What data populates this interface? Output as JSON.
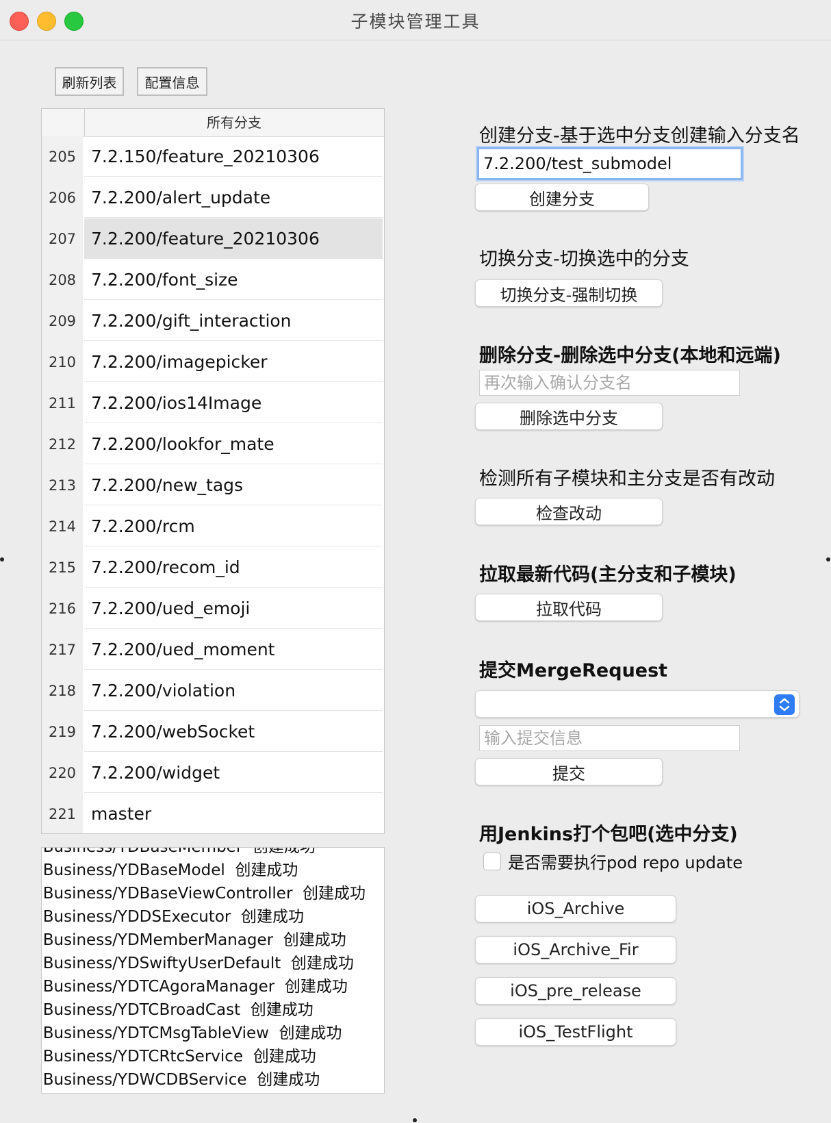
{
  "window": {
    "title": "子模块管理工具"
  },
  "toolbar": {
    "refresh_label": "刷新列表",
    "config_label": "配置信息"
  },
  "branches": {
    "header": "所有分支",
    "rows": [
      {
        "index": "205",
        "name": "7.2.150/feature_20210306"
      },
      {
        "index": "206",
        "name": "7.2.200/alert_update"
      },
      {
        "index": "207",
        "name": "7.2.200/feature_20210306"
      },
      {
        "index": "208",
        "name": "7.2.200/font_size"
      },
      {
        "index": "209",
        "name": "7.2.200/gift_interaction"
      },
      {
        "index": "210",
        "name": "7.2.200/imagepicker"
      },
      {
        "index": "211",
        "name": "7.2.200/ios14Image"
      },
      {
        "index": "212",
        "name": "7.2.200/lookfor_mate"
      },
      {
        "index": "213",
        "name": "7.2.200/new_tags"
      },
      {
        "index": "214",
        "name": "7.2.200/rcm"
      },
      {
        "index": "215",
        "name": "7.2.200/recom_id"
      },
      {
        "index": "216",
        "name": "7.2.200/ued_emoji"
      },
      {
        "index": "217",
        "name": "7.2.200/ued_moment"
      },
      {
        "index": "218",
        "name": "7.2.200/violation"
      },
      {
        "index": "219",
        "name": "7.2.200/webSocket"
      },
      {
        "index": "220",
        "name": "7.2.200/widget"
      },
      {
        "index": "221",
        "name": "master"
      }
    ],
    "selected_index": "207"
  },
  "log": {
    "lines": [
      ":Business/YDBaseMember  创建成功",
      ":Business/YDBaseModel  创建成功",
      ":Business/YDBaseViewController  创建成功",
      ":Business/YDDSExecutor  创建成功",
      ":Business/YDMemberManager  创建成功",
      ":Business/YDSwiftyUserDefault  创建成功",
      ":Business/YDTCAgoraManager  创建成功",
      ":Business/YDTCBroadCast  创建成功",
      ":Business/YDTCMsgTableView  创建成功",
      ":Business/YDTCRtcService  创建成功",
      ":Business/YDWCDBService  创建成功"
    ]
  },
  "create_branch": {
    "title": "创建分支-基于选中分支创建输入分支名",
    "input_value": "7.2.200/test_submodel",
    "button": "创建分支"
  },
  "switch_branch": {
    "title": "切换分支-切换选中的分支",
    "button": "切换分支-强制切换"
  },
  "delete_branch": {
    "title": "删除分支-删除选中分支(本地和远端)",
    "placeholder": "再次输入确认分支名",
    "button": "删除选中分支"
  },
  "check_changes": {
    "title": "检测所有子模块和主分支是否有改动",
    "button": "检查改动"
  },
  "pull_code": {
    "title": "拉取最新代码(主分支和子模块)",
    "button": "拉取代码"
  },
  "merge_request": {
    "title": "提交MergeRequest",
    "select_value": "",
    "placeholder": "输入提交信息",
    "button": "提交"
  },
  "jenkins": {
    "title": "用Jenkins打个包吧(选中分支)",
    "checkbox_label": "是否需要执行pod repo update",
    "checkbox_checked": false,
    "buttons": [
      "iOS_Archive",
      "iOS_Archive_Fir",
      "iOS_pre_release",
      "iOS_TestFlight"
    ]
  },
  "colors": {
    "close": "#fe5f57",
    "minimize": "#febc2e",
    "zoom": "#28c840",
    "focus_ring": "#8ab6f0",
    "accent": "#2f7cf6"
  }
}
